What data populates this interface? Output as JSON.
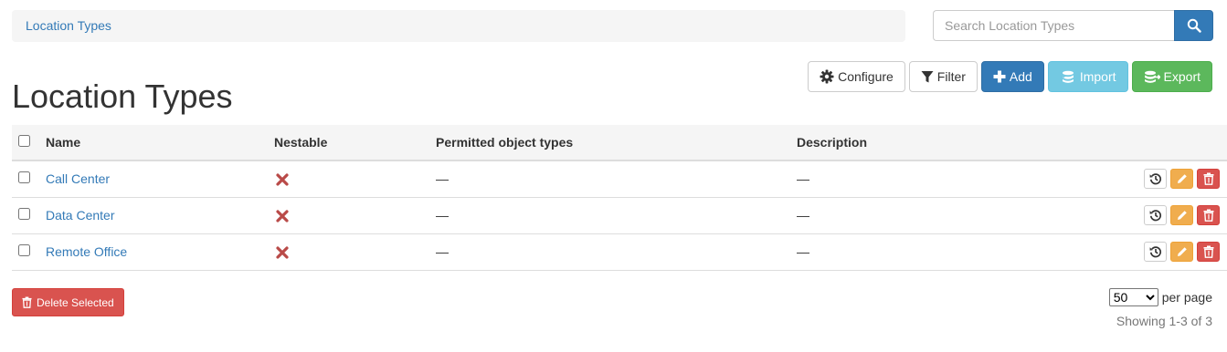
{
  "breadcrumb": {
    "label": "Location Types"
  },
  "search": {
    "placeholder": "Search Location Types"
  },
  "page": {
    "title": "Location Types"
  },
  "toolbar": {
    "configure_label": "Configure",
    "filter_label": "Filter",
    "add_label": "Add",
    "import_label": "Import",
    "export_label": "Export"
  },
  "table": {
    "headers": {
      "name": "Name",
      "nestable": "Nestable",
      "permitted": "Permitted object types",
      "description": "Description"
    },
    "rows": [
      {
        "name": "Call Center",
        "nestable": false,
        "permitted": "—",
        "description": "—"
      },
      {
        "name": "Data Center",
        "nestable": false,
        "permitted": "—",
        "description": "—"
      },
      {
        "name": "Remote Office",
        "nestable": false,
        "permitted": "—",
        "description": "—"
      }
    ]
  },
  "footer": {
    "delete_selected_label": "Delete Selected",
    "per_page_value": "50",
    "per_page_label": "per page",
    "showing_text": "Showing 1-3 of 3"
  },
  "colors": {
    "primary": "#337ab7",
    "info": "#5bc0de",
    "success": "#5cb85c",
    "warning": "#f0ad4e",
    "danger": "#d9534f",
    "cross": "#b94a48"
  }
}
